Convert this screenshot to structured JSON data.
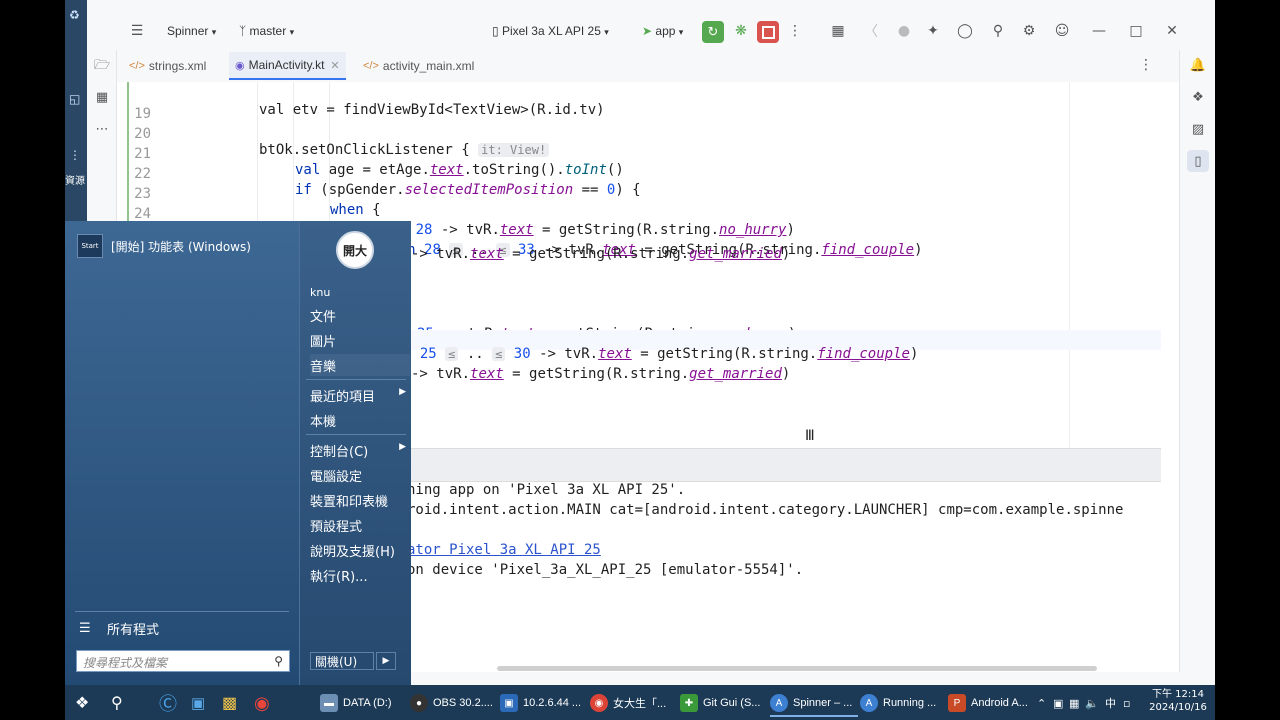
{
  "desktop": {
    "label": "資源",
    "icons": [
      "recycle-icon",
      "network-icon",
      "more-icon"
    ]
  },
  "toolbar": {
    "project": "Spinner",
    "branch": "master",
    "device": "Pixel 3a XL API 25",
    "run_config": "app",
    "icons": [
      "menu-icon",
      "run-icon",
      "debug-icon",
      "stop-icon",
      "more-vertical-icon",
      "build-icon",
      "translate-icon",
      "bug-icon",
      "device-manager-icon",
      "search-icon",
      "settings-icon",
      "account-icon",
      "minimize-icon",
      "maximize-icon",
      "close-icon"
    ]
  },
  "tabs": [
    {
      "label": "strings.xml",
      "type": "xml"
    },
    {
      "label": "MainActivity.kt",
      "type": "kotlin",
      "active": true
    },
    {
      "label": "activity_main.xml",
      "type": "xml"
    }
  ],
  "editor": {
    "lines": [
      {
        "n": "",
        "code": "val etv = findViewById<TextView>(R.id.tv)"
      },
      {
        "n": "19",
        "code": ""
      },
      {
        "n": "20",
        "code": "btOk.setOnClickListener {",
        "hint": "it: View!"
      },
      {
        "n": "21",
        "code": "val age = etAge.text.toString().toInt()"
      },
      {
        "n": "22",
        "code": "if (spGender.selectedItemPosition == 0) {"
      },
      {
        "n": "23",
        "code": "when {"
      },
      {
        "n": "24",
        "code": "age < 28 -> tvR.text = getString(R.string.no_hurry)"
      },
      {
        "n": "25",
        "code": "age in 28 ≤ .. ≤ 33 -> tvR.text = getString(R.string.find_couple)"
      },
      {
        "n": "",
        "code": "-> tvR.text = getString(R.string.get_married)"
      },
      {
        "n": "",
        "code": ""
      },
      {
        "n": "",
        "code": ""
      },
      {
        "n": "",
        "code": "25 -> tvR.text = getString(R.string.no_hurry)"
      },
      {
        "n": "",
        "code": "n 25 ≤ .. ≤ 30 -> tvR.text = getString(R.string.find_couple)"
      },
      {
        "n": "",
        "code": "-> tvR.text = getString(R.string.get_married)"
      }
    ]
  },
  "console": {
    "lines": [
      "hing app on 'Pixel 3a XL API 25'.",
      "roid.intent.action.MAIN cat=[android.intent.category.LAUNCHER] cmp=com.example.spinne",
      "",
      "ator Pixel 3a XL API 25",
      "on device 'Pixel_3a_XL_API_25 [emulator-5554]'."
    ]
  },
  "start_menu": {
    "pinned": {
      "label": "[開始] 功能表 (Windows)",
      "icon_text": "Start"
    },
    "all_programs": "所有程式",
    "search_placeholder": "搜尋程式及檔案",
    "user": "knu",
    "avatar_text": "開大",
    "right_items": [
      {
        "label": "文件"
      },
      {
        "label": "圖片"
      },
      {
        "label": "音樂"
      },
      {
        "label": "最近的項目",
        "submenu": true
      },
      {
        "label": "本機"
      },
      {
        "label": "控制台(C)",
        "submenu": true
      },
      {
        "label": "電腦設定"
      },
      {
        "label": "裝置和印表機"
      },
      {
        "label": "預設程式"
      },
      {
        "label": "說明及支援(H)"
      },
      {
        "label": "執行(R)..."
      }
    ],
    "shutdown": "關機(U)"
  },
  "taskbar": {
    "items": [
      {
        "label": "DATA (D:)",
        "icon": "drive-icon",
        "color": "#6c8fb3"
      },
      {
        "label": "OBS 30.2....",
        "icon": "obs-icon",
        "color": "#333333"
      },
      {
        "label": "10.2.6.44 ...",
        "icon": "remote-desktop-icon",
        "color": "#2a6ab8"
      },
      {
        "label": "女大生「...",
        "icon": "chrome-icon",
        "color": "#db4437"
      },
      {
        "label": "Git Gui (S...",
        "icon": "git-icon",
        "color": "#3a9a3a"
      },
      {
        "label": "Spinner – ...",
        "icon": "android-studio-icon",
        "color": "#3d7fd1"
      },
      {
        "label": "Running ...",
        "icon": "android-studio-icon",
        "color": "#3d7fd1"
      },
      {
        "label": "Android A...",
        "icon": "powerpoint-icon",
        "color": "#c94a27"
      }
    ],
    "tray_ime": "中",
    "clock_time": "下午 12:14",
    "clock_date": "2024/10/16"
  }
}
